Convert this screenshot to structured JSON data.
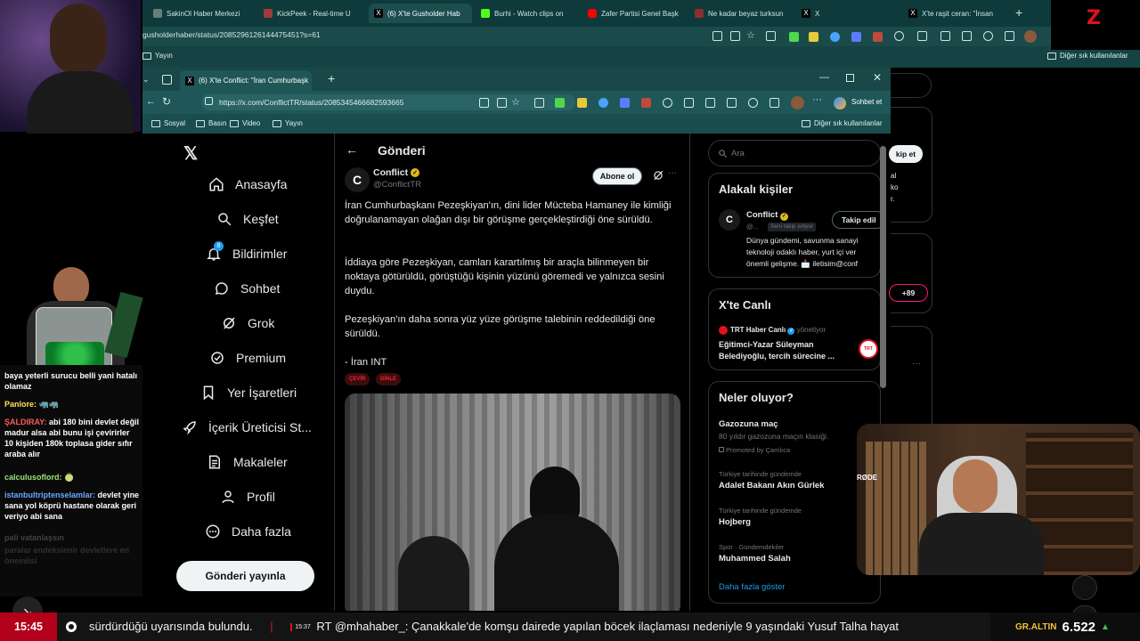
{
  "back_browser": {
    "tabs": [
      {
        "label": "SakinOl Haber Merkezi",
        "color": "#6b7c7c"
      },
      {
        "label": "KickPeek - Real-time U",
        "color": "#a33a3a"
      },
      {
        "label": "(6) X'te Gusholder Hab",
        "color": "#000000"
      },
      {
        "label": "Burhi - Watch clips on",
        "color": "#53fc18"
      },
      {
        "label": "Zafer Partisi Genel Başk",
        "color": "#ff0000"
      },
      {
        "label": "Ne kadar beyaz turksun",
        "color": "#8a3030"
      },
      {
        "label": "X",
        "color": "#000000"
      },
      {
        "label": "X'te raşit ceran: \"İnsan",
        "color": "#000000"
      }
    ],
    "url": "gusholderhaber/status/2085296126144475451?s=61",
    "fav_item": "Yayın",
    "fav_other": "Diğer sık kullanılanlar"
  },
  "front_browser": {
    "tab_title": "(6) X'te Conflict: \"İran Cumhurbaşk",
    "url": "https://x.com/ConflictTR/status/2085345466682593665",
    "copilot": "Sohbet et",
    "favorites": [
      "Sosyal",
      "Basın",
      "Video",
      "Yayın"
    ],
    "fav_other": "Diğer sık kullanılanlar"
  },
  "x_nav": {
    "items": [
      {
        "label": "Anasayfa",
        "icon": "home-icon"
      },
      {
        "label": "Keşfet",
        "icon": "search-icon"
      },
      {
        "label": "Bildirimler",
        "icon": "bell-icon",
        "badge": "8"
      },
      {
        "label": "Sohbet",
        "icon": "chat-icon"
      },
      {
        "label": "Grok",
        "icon": "grok-icon"
      },
      {
        "label": "Premium",
        "icon": "premium-icon"
      },
      {
        "label": "Yer İşaretleri",
        "icon": "bookmark-icon"
      },
      {
        "label": "İçerik Üreticisi St...",
        "icon": "rocket-icon"
      },
      {
        "label": "Makaleler",
        "icon": "article-icon"
      },
      {
        "label": "Profil",
        "icon": "profile-icon"
      },
      {
        "label": "Daha fazla",
        "icon": "more-icon"
      }
    ],
    "post_button": "Gönderi yayınla"
  },
  "post": {
    "header": "Gönderi",
    "author_name": "Conflict",
    "author_handle": "@ConflictTR",
    "subscribe": "Abone ol",
    "paragraphs": [
      "İran Cumhurbaşkanı Pezeşkiyan'ın, dini lider Mücteba Hamaney ile kimliği doğrulanamayan olağan dışı bir görüşme gerçekleştirdiği öne sürüldü.",
      "İddiaya göre Pezeşkiyan, camları karartılmış bir araçla bilinmeyen bir noktaya götürüldü, görüştüğü kişinin yüzünü göremedi ve yalnızca sesini duydu.",
      "Pezeşkiyan'ın daha sonra yüz yüze görüşme talebinin reddedildiği öne sürüldü.",
      "- İran INT"
    ],
    "tags": [
      "ÇEVİR",
      "DİNLE"
    ]
  },
  "right_col": {
    "search_placeholder": "Ara",
    "related": {
      "title": "Alakalı kişiler",
      "name": "Conflict",
      "handle": "@...",
      "follows_you": "Seni takip ediyor",
      "follow_btn": "Takip edil",
      "bio": [
        "Dünya gündemi, savunma sanayi",
        "teknoloji odaklı haber, yurt içi ver",
        "önemli gelişme. 📩 iletisim@conf"
      ]
    },
    "live": {
      "title": "X'te Canlı",
      "source": "TRT Haber Canlı",
      "role": "yönetiyor",
      "topic": [
        "Eğitimci-Yazar Süleyman",
        "Belediyoğlu, tercih sürecine ..."
      ]
    },
    "trends": {
      "title": "Neler oluyor?",
      "items": [
        {
          "meta": "",
          "name": "Gazozuna maç",
          "extra": "80 yıldır gazozuna maçın klasiği.",
          "promo": "Promoted by Çamlıca"
        },
        {
          "meta": "Türkiye tarihinde gündemde",
          "name": "Adalet Bakanı Akın Gürlek"
        },
        {
          "meta": "Türkiye tarihinde gündemde",
          "name": "Hojberg"
        },
        {
          "meta": "Spor · Gündemdekiler",
          "name": "Muhammed Salah"
        }
      ],
      "show_more": "Daha fazla göster"
    }
  },
  "behind_right": {
    "follow": "kip et",
    "snips": [
      "al",
      "ko",
      "r."
    ],
    "count": "+89"
  },
  "chat": [
    {
      "user": "",
      "text": "baya yeterli surucu belli yani hatalı olamaz",
      "color": "#ffffff"
    },
    {
      "user": "Panlore:",
      "text": "🦏🦏",
      "color": "#ffe35a"
    },
    {
      "user": "ŞALDIRAY:",
      "text": "abi 180 bini devlet değil madur alsa abi bunu işi çevirirler 10 kişiden 180k toplasa gider sıfır araba alır",
      "color": "#ff5a5a"
    },
    {
      "user": "calculusoflord:",
      "text": "🍈",
      "color": "#9be37a"
    },
    {
      "user": "istanbultriptenselamlar:",
      "text": "devlet yine sana yol köprü hastane olarak geri veriyo abi sana",
      "color": "#6aa8ff"
    },
    {
      "user": "",
      "text": "pali vatanlaşsın",
      "color": "#888888"
    },
    {
      "user": "",
      "text": "paralar endekslenir devletlere en önemlisi",
      "color": "#777777"
    }
  ],
  "ticker": {
    "time": "15:45",
    "text1": "sürdürdüğü uyarısında bulundu.",
    "sep": "|",
    "time2": "15:37",
    "text2": "RT @mhahaber_: Çanakkale'de komşu dairede yapılan böcek ilaçlaması nedeniyle 9 yaşındaki Yusuf Talha hayat",
    "gold_label": "GR.ALTIN",
    "gold_value": "6.522",
    "gold_trend": "▲"
  },
  "colors": {
    "accent": "#1d9bf0",
    "brand_red": "#e3101e",
    "ticker_red": "#b3001b",
    "gold": "#f2c230"
  }
}
